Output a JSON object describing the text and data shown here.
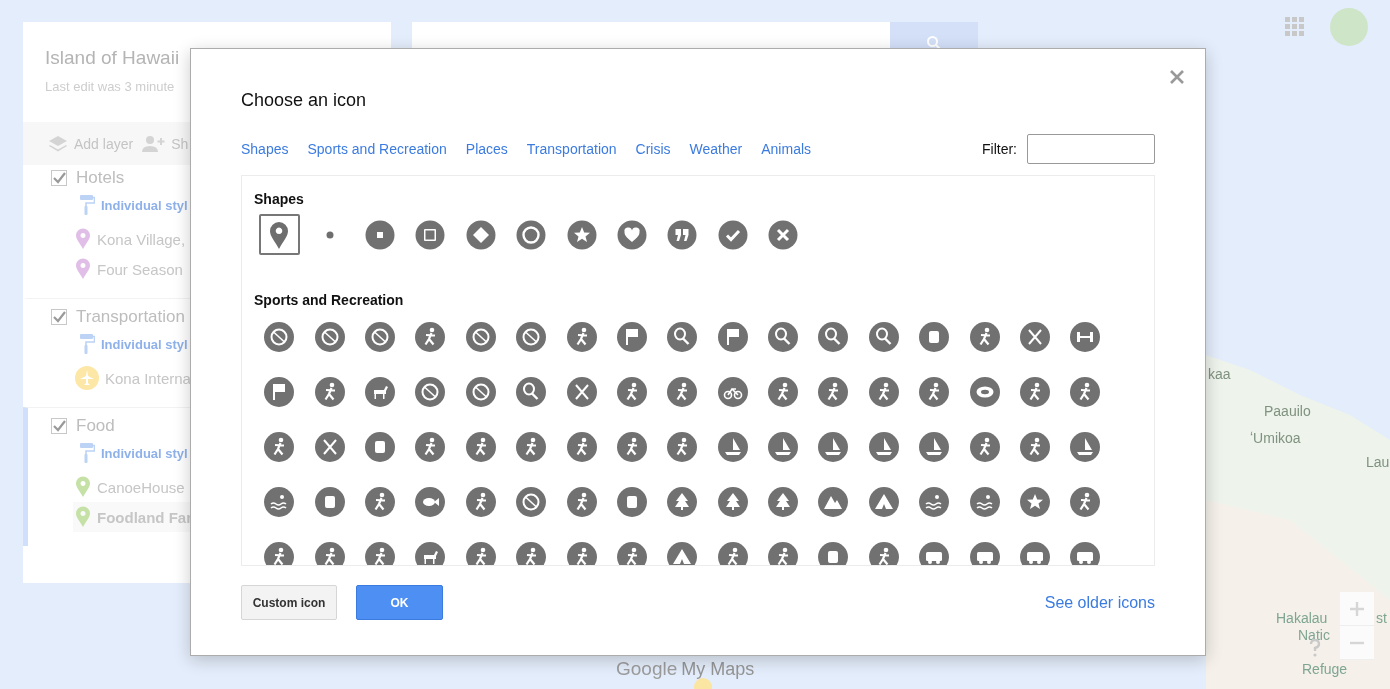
{
  "map": {
    "labels": [
      "kaa",
      "Paauilo",
      "ʻUmikoa",
      "Lau",
      "Hakalau",
      "st",
      "Natic",
      "Refuge"
    ],
    "logo": {
      "brand": "Google",
      "product": "My Maps"
    }
  },
  "sidebar": {
    "title": "Island of Hawaii",
    "subtitle": "Last edit was 3 minute",
    "toolbar": [
      "Add layer",
      "Sh"
    ],
    "layers": [
      {
        "name": "Hotels",
        "checked": true,
        "selected": false,
        "style_link": "Individual styl",
        "places": [
          {
            "name": "Kona Village,",
            "kind": "pin",
            "color": "#e1bee7",
            "selected": false
          },
          {
            "name": "Four Season",
            "kind": "pin",
            "color": "#e1bee7",
            "selected": false
          }
        ]
      },
      {
        "name": "Transportation",
        "checked": true,
        "selected": false,
        "style_link": "Individual styl",
        "places": [
          {
            "name": "Kona Interna",
            "kind": "plane",
            "color": "#fde7a6",
            "selected": false
          }
        ]
      },
      {
        "name": "Food",
        "checked": true,
        "selected": true,
        "style_link": "Individual styl",
        "places": [
          {
            "name": "CanoeHouse",
            "kind": "pin",
            "color": "#c5e1a5",
            "selected": false
          },
          {
            "name": "Foodland Far",
            "kind": "pin",
            "color": "#c5e1a5",
            "selected": true
          }
        ]
      }
    ]
  },
  "dialog": {
    "title": "Choose an icon",
    "categories": [
      "Shapes",
      "Sports and Recreation",
      "Places",
      "Transportation",
      "Crisis",
      "Weather",
      "Animals"
    ],
    "filter": {
      "label": "Filter:"
    },
    "sections": [
      {
        "heading": "Shapes",
        "kind": "shapes",
        "icons": [
          {
            "selected": true
          },
          {
            "selected": false
          },
          {
            "selected": false
          },
          {
            "selected": false
          },
          {
            "selected": false
          },
          {
            "selected": false
          },
          {
            "selected": false
          },
          {
            "selected": false
          },
          {
            "selected": false
          },
          {
            "selected": false
          },
          {
            "selected": false
          }
        ]
      },
      {
        "heading": "Sports and Recreation",
        "kind": "sports"
      }
    ],
    "buttons": [
      {
        "label": "Custom icon",
        "kind": "secondary"
      },
      {
        "label": "OK",
        "kind": "primary"
      }
    ],
    "link": "See older icons"
  }
}
